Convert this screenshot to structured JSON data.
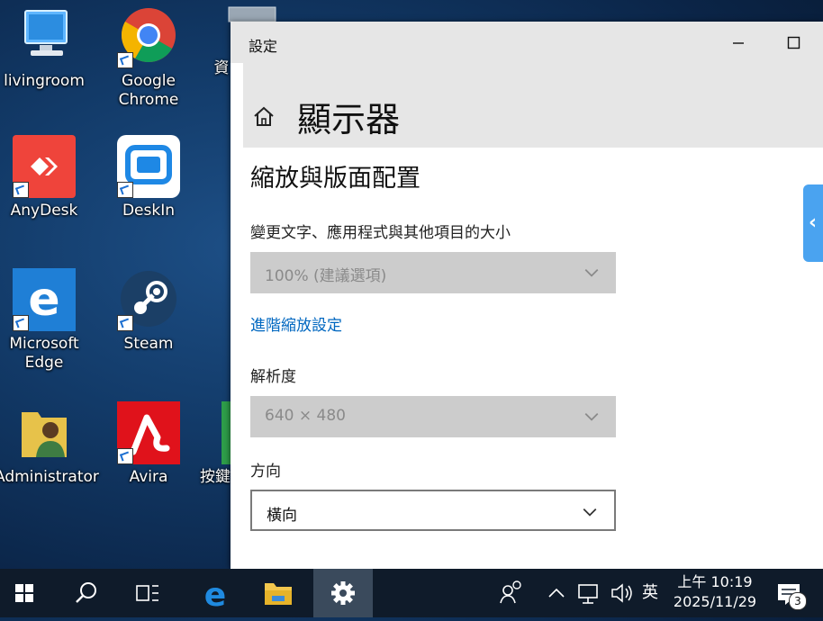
{
  "desktop": {
    "icons": [
      {
        "label": "livingroom"
      },
      {
        "label": "Google\nChrome"
      },
      {
        "label": "資"
      },
      {
        "label": "AnyDesk"
      },
      {
        "label": "DeskIn"
      },
      {
        "label": "Microsoft\nEdge"
      },
      {
        "label": "Steam"
      },
      {
        "label": "Administrator"
      },
      {
        "label": "Avira"
      },
      {
        "label": "按鍵"
      }
    ]
  },
  "window": {
    "title": "設定",
    "page_title": "顯示器",
    "section_title": "縮放與版面配置",
    "scale": {
      "label": "變更文字、應用程式與其他項目的大小",
      "value": "100% (建議選項)"
    },
    "advanced_link": "進階縮放設定",
    "resolution": {
      "label": "解析度",
      "value": "640 × 480"
    },
    "orientation": {
      "label": "方向",
      "value": "橫向"
    },
    "side_tab_glyph": "‹"
  },
  "taskbar": {
    "ime": "英",
    "time": "上午 10:19",
    "date": "2025/11/29",
    "notification_count": "3",
    "icons": [
      "start-icon",
      "search-icon",
      "task-view-icon",
      "edge-icon",
      "file-explorer-icon",
      "settings-icon",
      "people-icon",
      "chevron-up-icon",
      "network-icon",
      "volume-icon",
      "notification-icon"
    ]
  },
  "colors": {
    "accent": "#0067c0",
    "taskbar": "#0f1b2a",
    "side_tab": "#4aa3f0"
  }
}
